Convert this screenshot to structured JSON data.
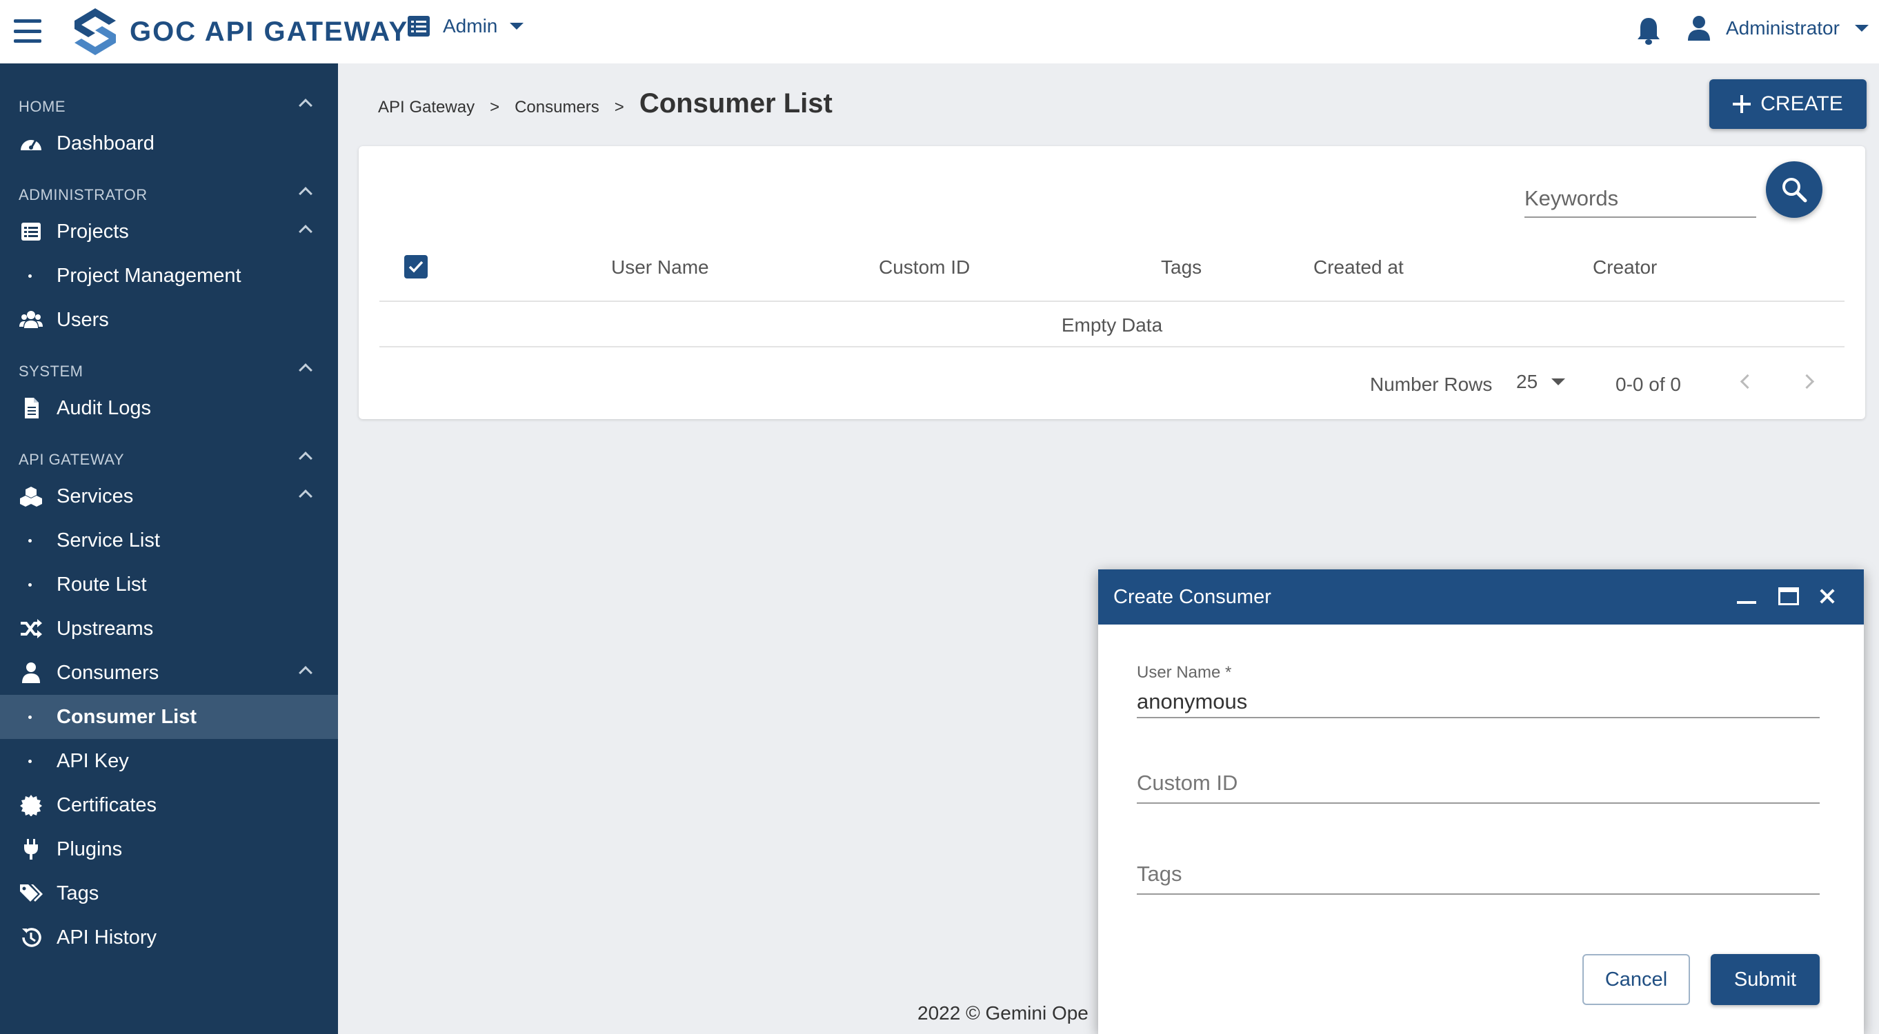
{
  "colors": {
    "primary": "#1f4e82",
    "sidebar": "#1b3a5a",
    "sidebar_active": "#3a5876",
    "background": "#eceef1"
  },
  "topbar": {
    "brand": "GOC API GATEWAY",
    "admin_menu": "Admin",
    "user_menu": "Administrator",
    "icons": [
      "hamburger-icon",
      "logo-icon",
      "list-icon",
      "bell-icon",
      "user-icon"
    ]
  },
  "sidebar": {
    "sections": {
      "home": "HOME",
      "administrator": "ADMINISTRATOR",
      "system": "SYSTEM",
      "api_gateway": "API GATEWAY"
    },
    "items": {
      "dashboard": "Dashboard",
      "projects": "Projects",
      "project_management": "Project Management",
      "users": "Users",
      "audit_logs": "Audit Logs",
      "services": "Services",
      "service_list": "Service List",
      "route_list": "Route List",
      "upstreams": "Upstreams",
      "consumers": "Consumers",
      "consumer_list": "Consumer List",
      "api_key": "API Key",
      "certificates": "Certificates",
      "plugins": "Plugins",
      "tags": "Tags",
      "api_history": "API History"
    },
    "active_item": "Consumer List"
  },
  "breadcrumb": {
    "items": [
      "API Gateway",
      "Consumers"
    ],
    "separator": ">",
    "current": "Consumer List"
  },
  "create_button": {
    "label": "CREATE"
  },
  "table": {
    "search_placeholder": "Keywords",
    "columns": [
      "User Name",
      "Custom ID",
      "Tags",
      "Created at",
      "Creator"
    ],
    "empty_text": "Empty Data",
    "rows": [],
    "select_all_checked": true
  },
  "pagination": {
    "rows_label": "Number Rows",
    "rows_per_page": "25",
    "range": "0-0 of 0"
  },
  "footer": {
    "copyright": "2022 © Gemini Ope"
  },
  "dialog": {
    "title": "Create Consumer",
    "fields": {
      "user_name": {
        "label": "User Name *",
        "value": "anonymous"
      },
      "custom_id": {
        "placeholder": "Custom ID"
      },
      "tags": {
        "placeholder": "Tags"
      }
    },
    "cancel_label": "Cancel",
    "submit_label": "Submit"
  }
}
